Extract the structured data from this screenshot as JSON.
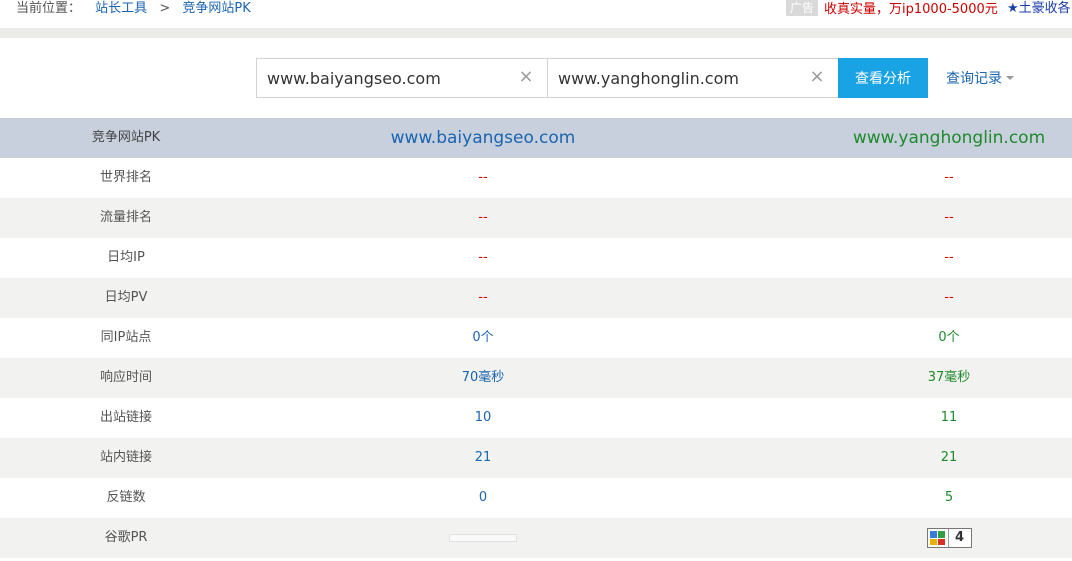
{
  "breadcrumb": {
    "label": "当前位置：",
    "items": [
      "站长工具",
      "竞争网站PK"
    ],
    "separator": ">"
  },
  "ad": {
    "tag": "广告",
    "text": "收真实量，万ip1000-5000元",
    "star_text": "★土豪收各"
  },
  "search": {
    "site_a": "www.baiyangseo.com",
    "site_b": "www.yanghonglin.com",
    "clear_glyph": "×",
    "analyze_label": "查看分析",
    "history_label": "查询记录"
  },
  "table": {
    "header": {
      "label": "竞争网站PK",
      "site_a": "www.baiyangseo.com",
      "site_b": "www.yanghonglin.com"
    },
    "rows": [
      {
        "label": "世界排名",
        "a": "--",
        "b": "--"
      },
      {
        "label": "流量排名",
        "a": "--",
        "b": "--"
      },
      {
        "label": "日均IP",
        "a": "--",
        "b": "--"
      },
      {
        "label": "日均PV",
        "a": "--",
        "b": "--"
      },
      {
        "label": "同IP站点",
        "a": "0个",
        "b": "0个"
      },
      {
        "label": "响应时间",
        "a": "70毫秒",
        "b": "37毫秒"
      },
      {
        "label": "出站链接",
        "a": "10",
        "b": "11"
      },
      {
        "label": "站内链接",
        "a": "21",
        "b": "21"
      },
      {
        "label": "反链数",
        "a": "0",
        "b": "5"
      },
      {
        "label": "谷歌PR",
        "a": "",
        "b": "4"
      }
    ]
  },
  "colors": {
    "accent_button": "#1aa3e4",
    "header_band": "#c7d0dc",
    "site_a_color": "#1a64b0",
    "site_b_color": "#1e8a2c",
    "dash_color": "#d40000"
  }
}
